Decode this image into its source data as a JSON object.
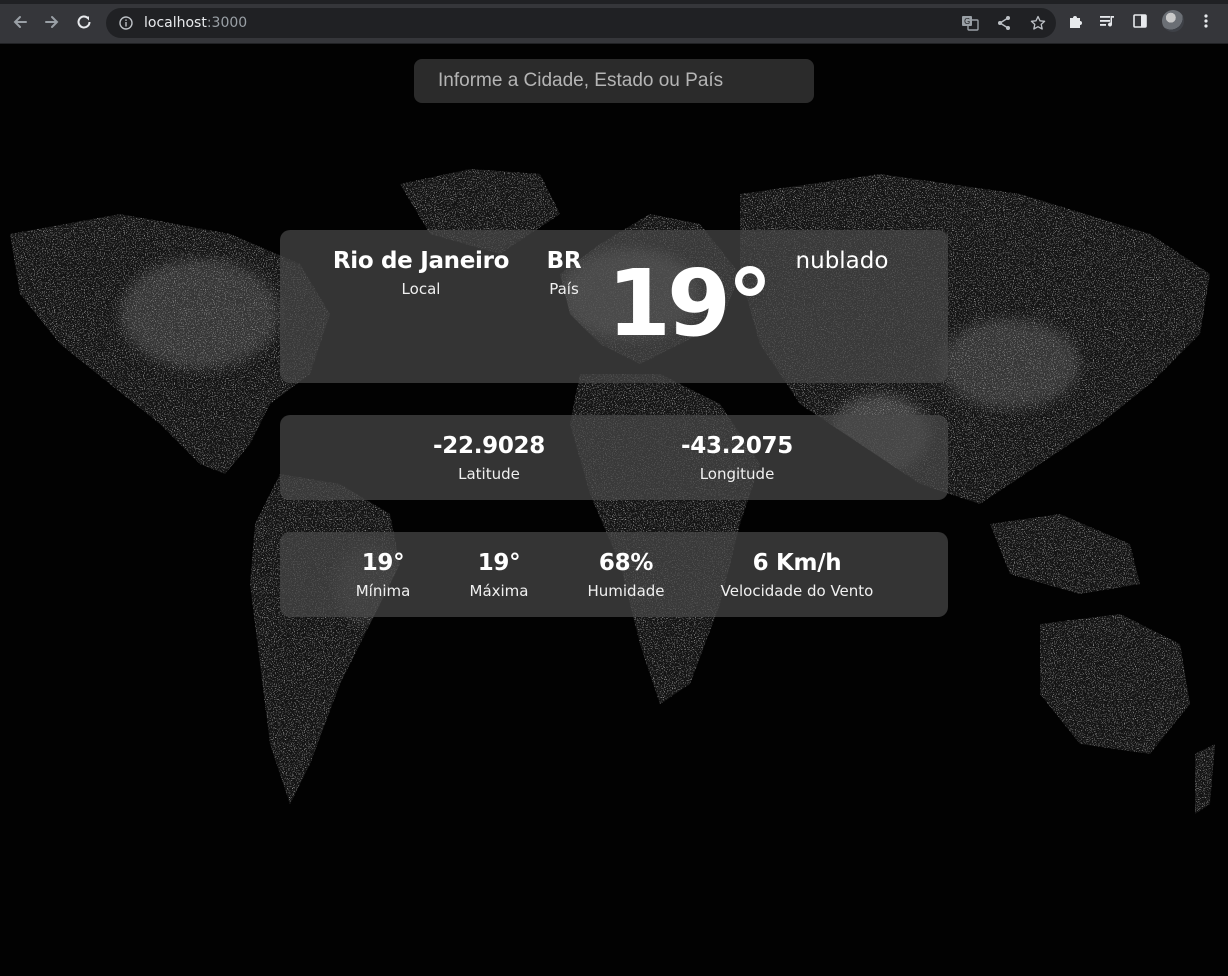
{
  "browser": {
    "url_host": "localhost",
    "url_port": ":3000",
    "colors": {
      "chrome": "#35363a",
      "omnibox": "#202124"
    }
  },
  "search": {
    "placeholder": "Informe a Cidade, Estado ou País"
  },
  "weather": {
    "city": "Rio de Janeiro",
    "city_label": "Local",
    "country": "BR",
    "country_label": "País",
    "temperature": "19°",
    "description": "nublado"
  },
  "coordinates": {
    "latitude": "-22.9028",
    "latitude_label": "Latitude",
    "longitude": "-43.2075",
    "longitude_label": "Longitude"
  },
  "stats": {
    "min": "19°",
    "min_label": "Mínima",
    "max": "19°",
    "max_label": "Máxima",
    "humidity": "68%",
    "humidity_label": "Humidade",
    "wind": "6 Km/h",
    "wind_label": "Velocidade do Vento"
  },
  "colors": {
    "background": "#000000",
    "card": "#484848",
    "text": "#ffffff"
  }
}
